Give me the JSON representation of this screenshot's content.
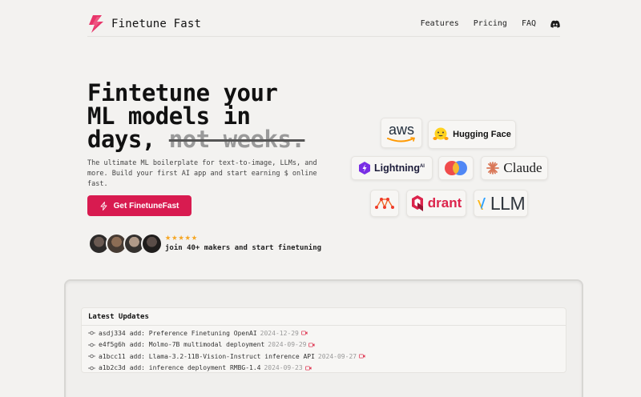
{
  "header": {
    "brand": "Finetune Fast",
    "nav": [
      "Features",
      "Pricing",
      "FAQ"
    ],
    "accent_color": "#d81b50"
  },
  "hero": {
    "title_line1": "Fintetune your",
    "title_line2": "ML models in",
    "title_line3_prefix": "days,",
    "title_strike": "not weeks.",
    "subtitle": "The ultimate ML boilerplate for text-to-image, LLMs, and more. Build your first AI app and start earning $ online fast.",
    "cta_label": "Get FinetuneFast",
    "stars": "★★★★★",
    "social_proof": "join 40+ makers and start finetuning"
  },
  "logos": {
    "aws": "aws",
    "huggingface": "Hugging Face",
    "lightning": "Lightning",
    "lightning_sup": "AI",
    "claude": "Claude",
    "qdrant": "drant",
    "vllm": "LLM"
  },
  "updates": {
    "title": "Latest Updates",
    "items": [
      {
        "hash": "asdj334",
        "message": "add: Preference Finetuning OpenAI",
        "date": "2024-12-29"
      },
      {
        "hash": "e4f5g6h",
        "message": "add: Molmo-7B multimodal deployment",
        "date": "2024-09-29"
      },
      {
        "hash": "a1bcc11",
        "message": "add: Llama-3.2-11B-Vision-Instruct inference API",
        "date": "2024-09-27"
      },
      {
        "hash": "a1b2c3d",
        "message": "add: inference deployment RMBG-1.4",
        "date": "2024-09-23"
      }
    ]
  }
}
